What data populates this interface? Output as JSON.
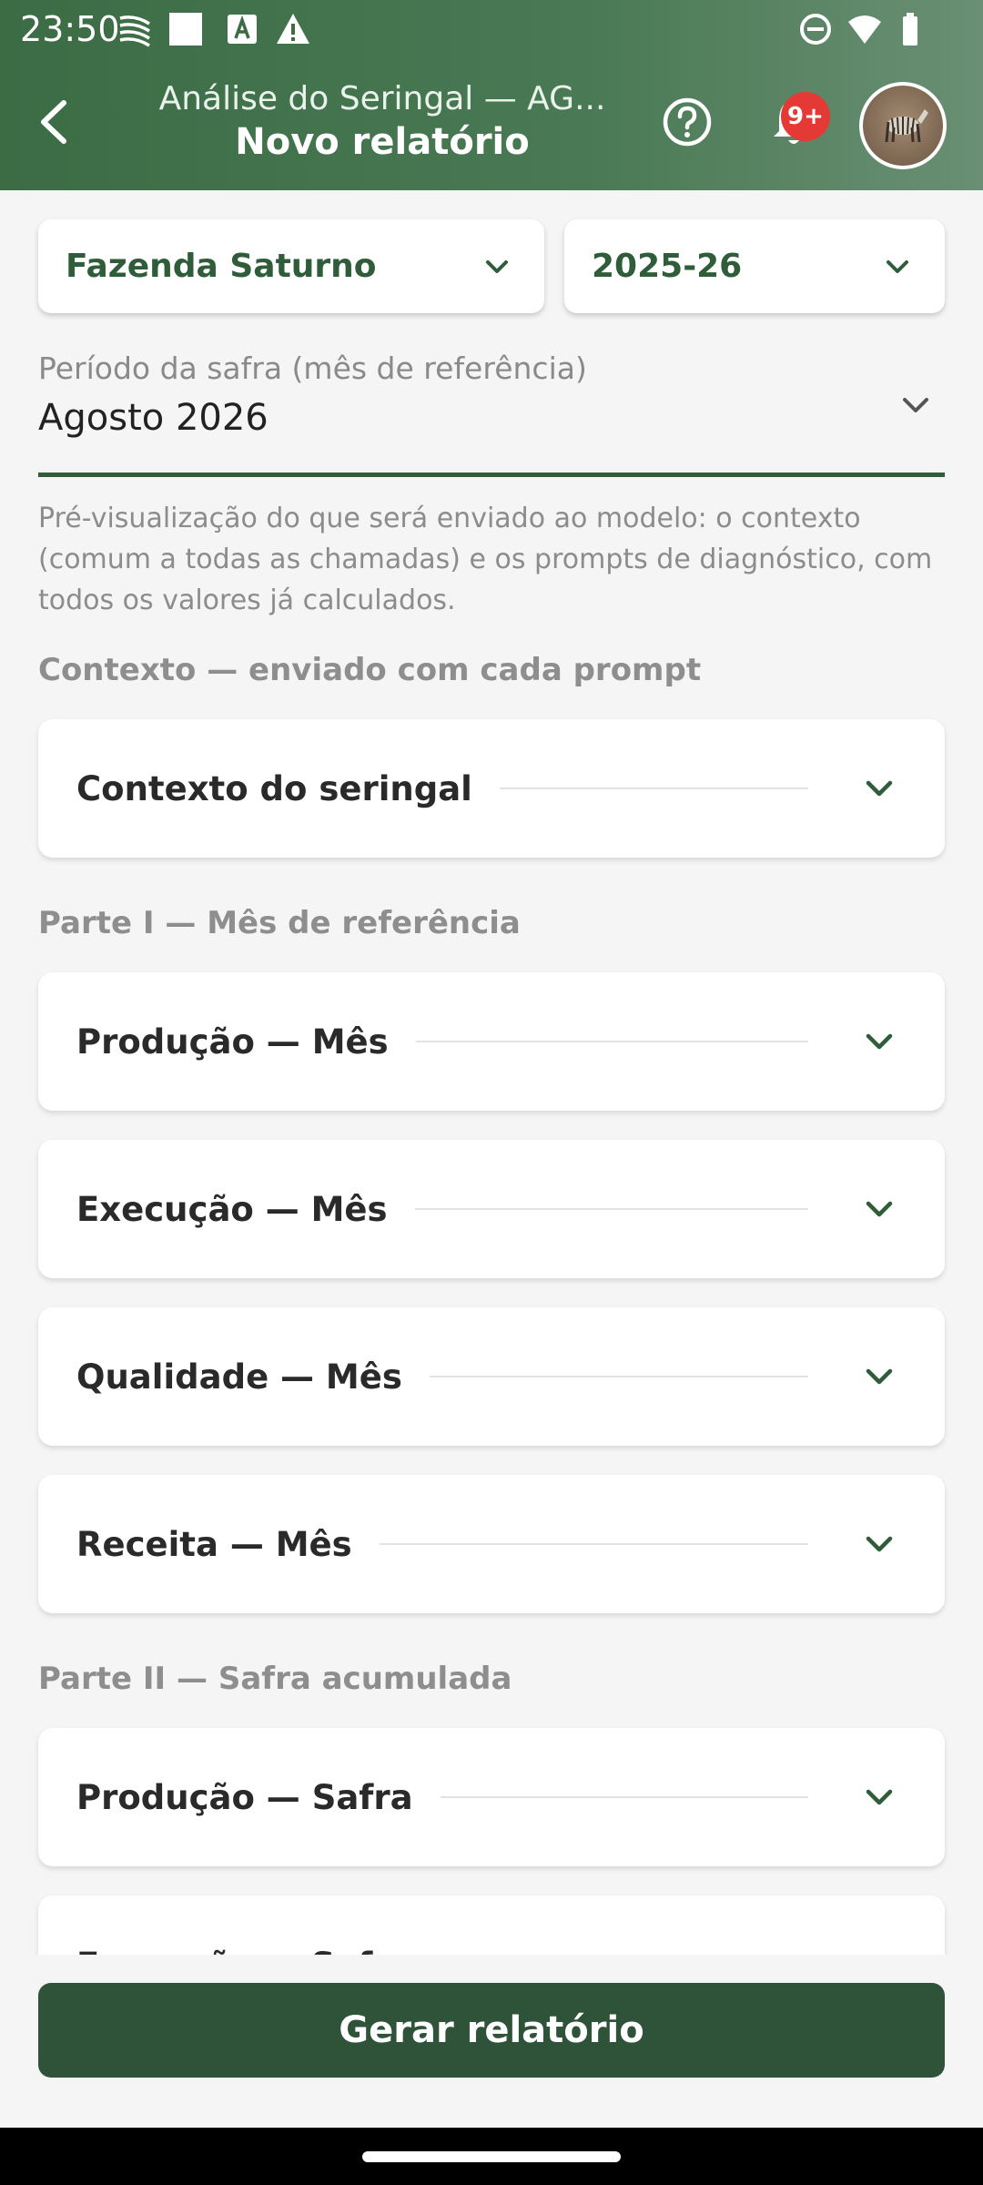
{
  "status_bar": {
    "time": "23:50",
    "left_icons": [
      "signal-lines-icon",
      "white-square-icon",
      "text-a-icon",
      "warning-icon"
    ],
    "right_icons": [
      "dnd-icon",
      "wifi-icon",
      "battery-icon"
    ]
  },
  "header": {
    "back_icon": "chevron-left-icon",
    "subtitle": "Análise do Seringal — AG...",
    "title": "Novo relatório",
    "help_icon": "help-circle-icon",
    "bell_icon": "bell-icon",
    "notification_badge": "9+",
    "avatar_icon": "zebra-avatar-icon",
    "colors": {
      "bar": "#3b6c44",
      "badge": "#e53935"
    }
  },
  "filters": {
    "farm": "Fazenda Saturno",
    "season": "2025-26"
  },
  "period": {
    "label": "Período da safra (mês de referência)",
    "value": "Agosto 2026"
  },
  "info_text": "Pré-visualização do que será enviado ao modelo: o contexto (comum a todas as chamadas) e os prompts de diagnóstico, com todos os valores já calculados.",
  "sections": {
    "context": {
      "title": "Contexto — enviado com cada prompt",
      "items": [
        "Contexto do seringal"
      ]
    },
    "part1": {
      "title": "Parte I — Mês de referência",
      "items": [
        "Produção — Mês",
        "Execução — Mês",
        "Qualidade — Mês",
        "Receita — Mês"
      ]
    },
    "part2": {
      "title": "Parte II — Safra acumulada",
      "items": [
        "Produção — Safra",
        "Execução — Safra"
      ]
    }
  },
  "actions": {
    "generate": "Gerar relatório",
    "button_color": "#2e5339"
  }
}
